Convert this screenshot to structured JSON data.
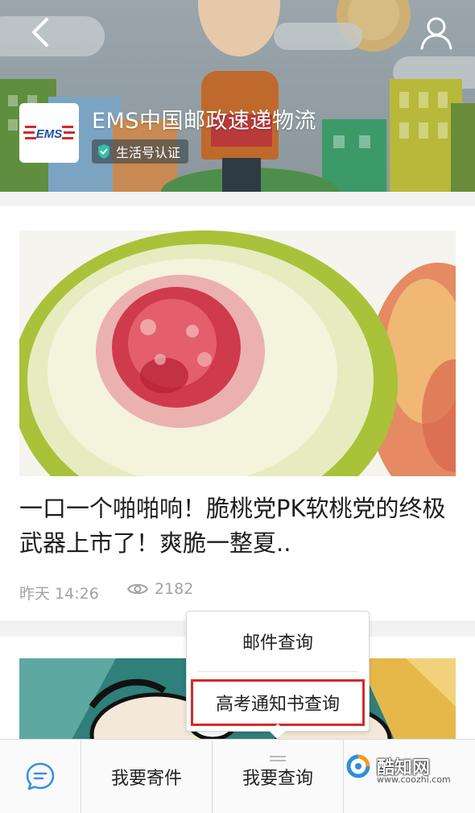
{
  "header": {
    "account_name": "EMS中国邮政速递物流",
    "verified_label": "生活号认证",
    "logo_text": "EMS",
    "icons": {
      "back": "chevron-left-icon",
      "user": "user-icon",
      "verified": "verified-check-icon"
    },
    "colors": {
      "logo_red": "#d12b2b",
      "logo_blue": "#1f4fa3",
      "badge_check": "#33c2a6"
    }
  },
  "article": {
    "title": "一口一个啪啪响！脆桃党PK软桃党的终极武器上市了！爽脆一整夏..",
    "time": "昨天 14:26",
    "views": "2182",
    "icons": {
      "views": "eye-icon"
    }
  },
  "popup_menu": {
    "items": [
      "邮件查询",
      "高考通知书查询"
    ],
    "highlight_color": "#d42a2a"
  },
  "bottom_bar": {
    "icon": "chat-bubble-icon",
    "menus": [
      "我要寄件",
      "我要查询"
    ],
    "accent": "#3f8de0"
  },
  "watermark": {
    "name": "酷知网",
    "url": "www.coozhi.com"
  }
}
